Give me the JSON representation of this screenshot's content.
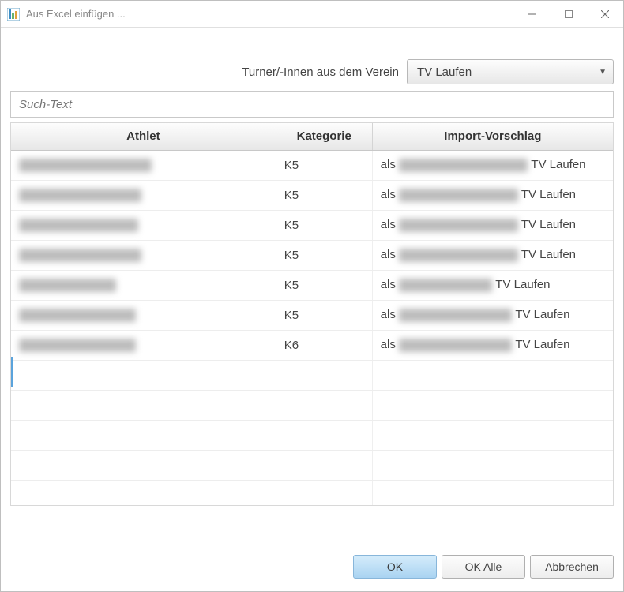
{
  "window": {
    "title": "Aus Excel einfügen ..."
  },
  "filter": {
    "label": "Turner/-Innen aus dem Verein",
    "selected": "TV Laufen"
  },
  "search": {
    "placeholder": "Such-Text",
    "value": ""
  },
  "table": {
    "headers": {
      "athlete": "Athlet",
      "category": "Kategorie",
      "suggestion": "Import-Vorschlag"
    },
    "rows": [
      {
        "athlete_blur": "Xxxxxxx xxxxxxxx, XXXX",
        "category": "K5",
        "sugg_prefix": "als",
        "sugg_blur": "Xxxxxxx xxxxxxxx XXXX",
        "sugg_suffix": "TV Laufen"
      },
      {
        "athlete_blur": "Xxxxxxxxxx Xxx, XXXX",
        "category": "K5",
        "sugg_prefix": "als",
        "sugg_blur": "Xxxxxxxxxx Xxx XXXX",
        "sugg_suffix": "TV Laufen"
      },
      {
        "athlete_blur": "Xxxxxxxx Xxxxx XXXX",
        "category": "K5",
        "sugg_prefix": "als",
        "sugg_blur": "Xxxxxxxx Xxxxx XXXX",
        "sugg_suffix": "TV Laufen"
      },
      {
        "athlete_blur": "Xxxxx Xxxxxxxx, XXXX",
        "category": "K5",
        "sugg_prefix": "als",
        "sugg_blur": "Xxxxx Xxxxxxxx XXXX",
        "sugg_suffix": "TV Laufen"
      },
      {
        "athlete_blur": "Xxxxx xxxx, XXXX",
        "category": "K5",
        "sugg_prefix": "als",
        "sugg_blur": "Xxxxx xxxx XXXX",
        "sugg_suffix": "TV Laufen"
      },
      {
        "athlete_blur": "Xxxxxxxx Xxxx, XXXX",
        "category": "K5",
        "sugg_prefix": "als",
        "sugg_blur": "Xxxxxxxx Xxxx XXXX",
        "sugg_suffix": "TV Laufen"
      },
      {
        "athlete_blur": "Xxxxxxxx Xxxx, XXXX",
        "category": "K6",
        "sugg_prefix": "als",
        "sugg_blur": "Xxxxxxxx Xxxx XXXX",
        "sugg_suffix": "TV Laufen"
      }
    ],
    "empty_rows": 5
  },
  "footer": {
    "ok": "OK",
    "ok_all": "OK Alle",
    "cancel": "Abbrechen"
  }
}
